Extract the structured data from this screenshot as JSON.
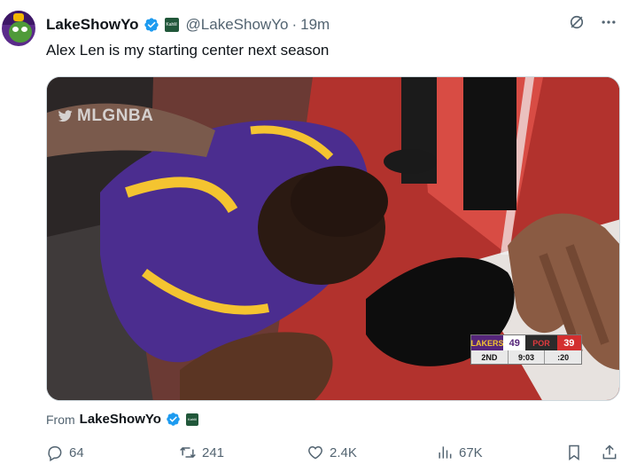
{
  "tweet": {
    "display_name": "LakeShowYo",
    "handle": "@LakeShowYo",
    "separator": "·",
    "time": "19m",
    "text": "Alex Len is my starting center next season",
    "affiliate_badge": "Kahlil",
    "from_label": "From",
    "from_name": "LakeShowYo"
  },
  "media": {
    "watermark": "MLGNBA",
    "scorebug": {
      "home_team": "LAKERS",
      "home_score": "49",
      "away_team": "POR",
      "away_score": "39",
      "quarter": "2ND",
      "game_clock": "9:03",
      "shot_clock": ":20"
    }
  },
  "actions": {
    "replies": "64",
    "reposts": "241",
    "likes": "2.4K",
    "views": "67K"
  },
  "colors": {
    "text_primary": "#0f1419",
    "text_secondary": "#536471",
    "verified_blue": "#1d9bf0",
    "lakers_purple": "#55257a",
    "lakers_gold": "#f4c430"
  },
  "icons": [
    "grok-icon",
    "more-icon",
    "reply-icon",
    "repost-icon",
    "like-icon",
    "views-icon",
    "bookmark-icon",
    "share-icon",
    "verified-icon"
  ]
}
